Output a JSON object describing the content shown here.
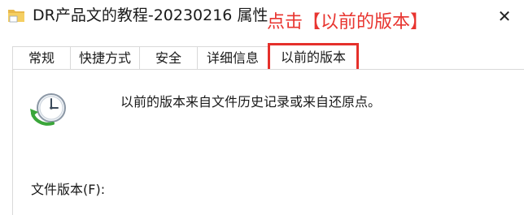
{
  "window": {
    "title": "DR产品文的教程-20230216 属性",
    "close_symbol": "✕",
    "icon": "folder-icon"
  },
  "annotation": {
    "text": "点击【以前的版本】",
    "color": "#e8342f"
  },
  "tabs": [
    {
      "label": "常规",
      "active": false
    },
    {
      "label": "快捷方式",
      "active": false
    },
    {
      "label": "安全",
      "active": false
    },
    {
      "label": "详细信息",
      "active": false
    },
    {
      "label": "以前的版本",
      "active": true,
      "highlight_color": "#e5302b"
    }
  ],
  "panel": {
    "description": "以前的版本来自文件历史记录或来自还原点。",
    "versions_label": "文件版本(F):",
    "icon": "clock-restore-icon"
  }
}
